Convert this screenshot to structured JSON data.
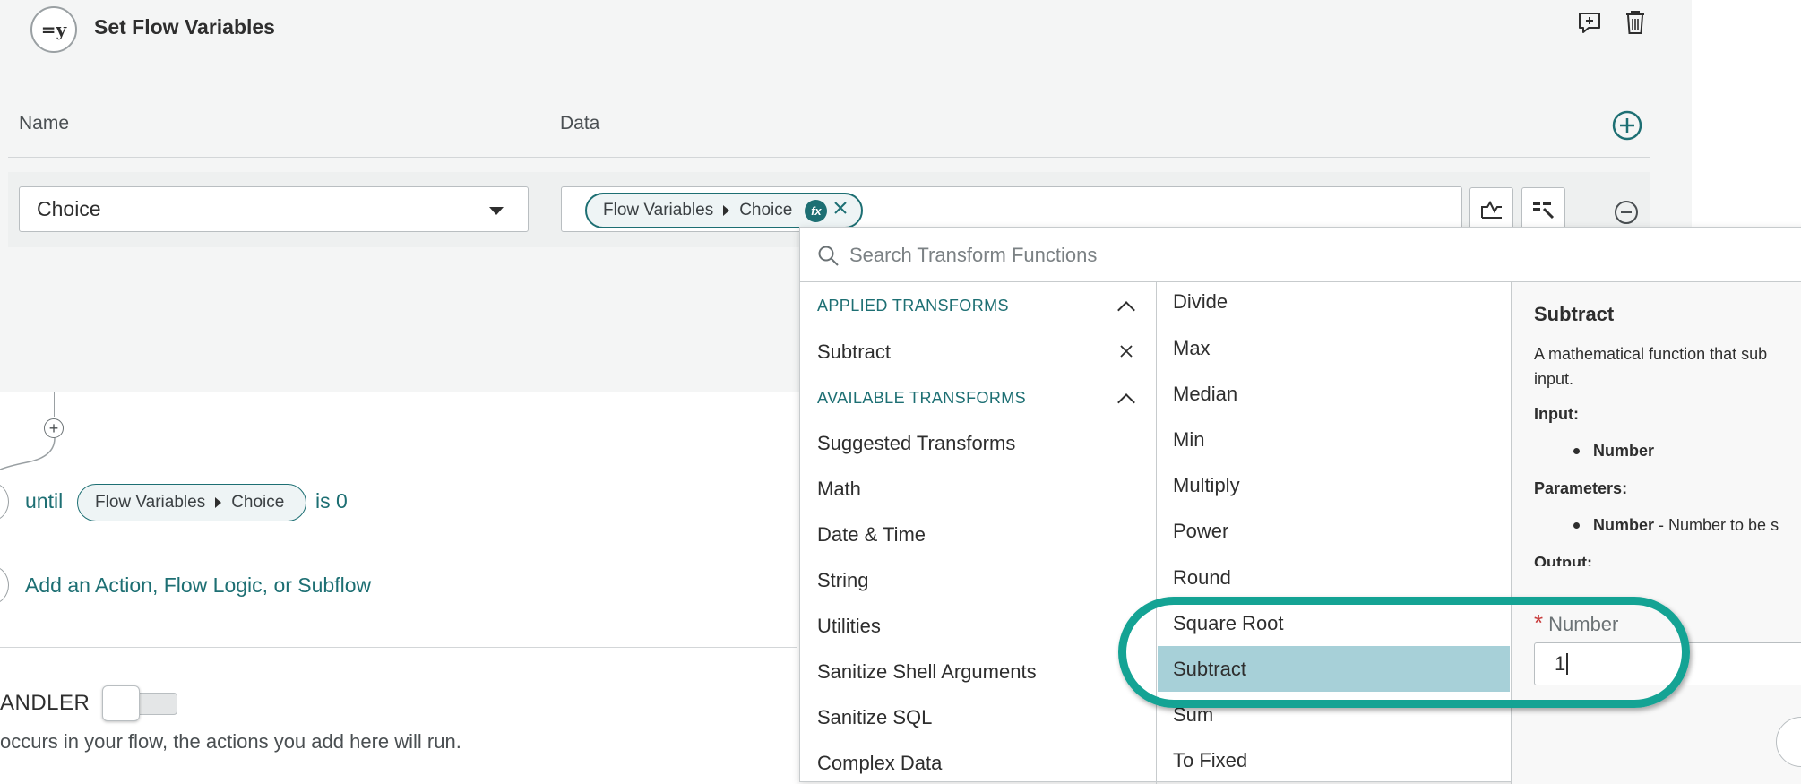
{
  "step": {
    "icon_text": "=y",
    "title": "Set Flow Variables",
    "columns": {
      "name": "Name",
      "data": "Data"
    },
    "row": {
      "name_value": "Choice",
      "pill": {
        "part1": "Flow Variables",
        "part2": "Choice",
        "badge": "fx"
      }
    }
  },
  "flow": {
    "until_label": "until",
    "until_pill": {
      "part1": "Flow Variables",
      "part2": "Choice"
    },
    "condition_suffix": "is 0",
    "add_action_label": "Add an Action, Flow Logic, or Subflow",
    "handler_label": "ANDLER",
    "handler_description": "occurs in your flow, the actions you add here will run."
  },
  "transforms": {
    "search_placeholder": "Search Transform Functions",
    "applied_header": "APPLIED TRANSFORMS",
    "applied": [
      "Subtract"
    ],
    "available_header": "AVAILABLE TRANSFORMS",
    "categories": [
      "Suggested Transforms",
      "Math",
      "Date & Time",
      "String",
      "Utilities",
      "Sanitize Shell Arguments",
      "Sanitize SQL",
      "Complex Data"
    ],
    "functions": [
      "Divide",
      "Max",
      "Median",
      "Min",
      "Multiply",
      "Power",
      "Round",
      "Square Root",
      "Subtract",
      "Sum",
      "To Fixed"
    ],
    "selected_function": "Subtract",
    "detail": {
      "title": "Subtract",
      "description_line1": "A mathematical function that sub",
      "description_line2": "input.",
      "input_label": "Input:",
      "input_item": "Number",
      "params_label": "Parameters:",
      "param_item_name": "Number",
      "param_item_desc": " - Number to be s",
      "output_label": "Output:",
      "number_label": "Number",
      "number_value": "1"
    }
  },
  "colors": {
    "accent": "#1d6f73",
    "selection": "#a7d0d8",
    "highlight_ring": "#14a394",
    "required": "#c83c3c"
  }
}
